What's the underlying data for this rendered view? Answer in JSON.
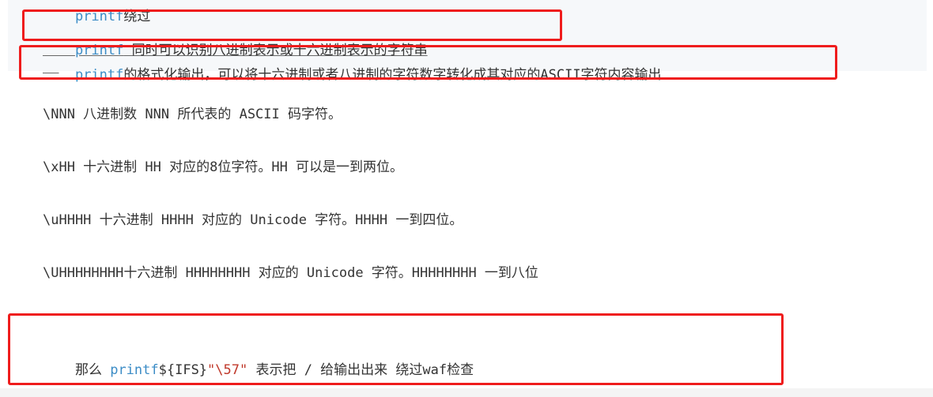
{
  "lines": {
    "line0": {
      "fn": "printf",
      "text": "绕过"
    },
    "line1": {
      "fn": "printf",
      "text": " 同时可以识别八进制表示或十六进制表示的字符串"
    },
    "line2": {
      "fn": "printf",
      "text": "的格式化输出，可以将十六进制或者八进制的字符数字转化成其对应的ASCII字符内容输出"
    },
    "line3": "\\NNN 八进制数 NNN 所代表的 ASCII 码字符。",
    "line4": "\\xHH 十六进制 HH 对应的8位字符。HH 可以是一到两位。",
    "line5": "\\uHHHH 十六进制 HHHH 对应的 Unicode 字符。HHHH 一到四位。",
    "line6": "\\UHHHHHHHH十六进制 HHHHHHHH 对应的 Unicode 字符。HHHHHHHH 一到八位",
    "line7": {
      "prefix": "那么 ",
      "fn": "printf",
      "ifs": "${IFS}",
      "str": "\"\\57\"",
      "suffix": " 表示把 / 给输出出来 绕过waf检查"
    }
  },
  "colors": {
    "highlight_box": "#ef1c1c",
    "function_name": "#3b8cc6",
    "string_literal": "#c0392b",
    "body_text": "#333333"
  }
}
